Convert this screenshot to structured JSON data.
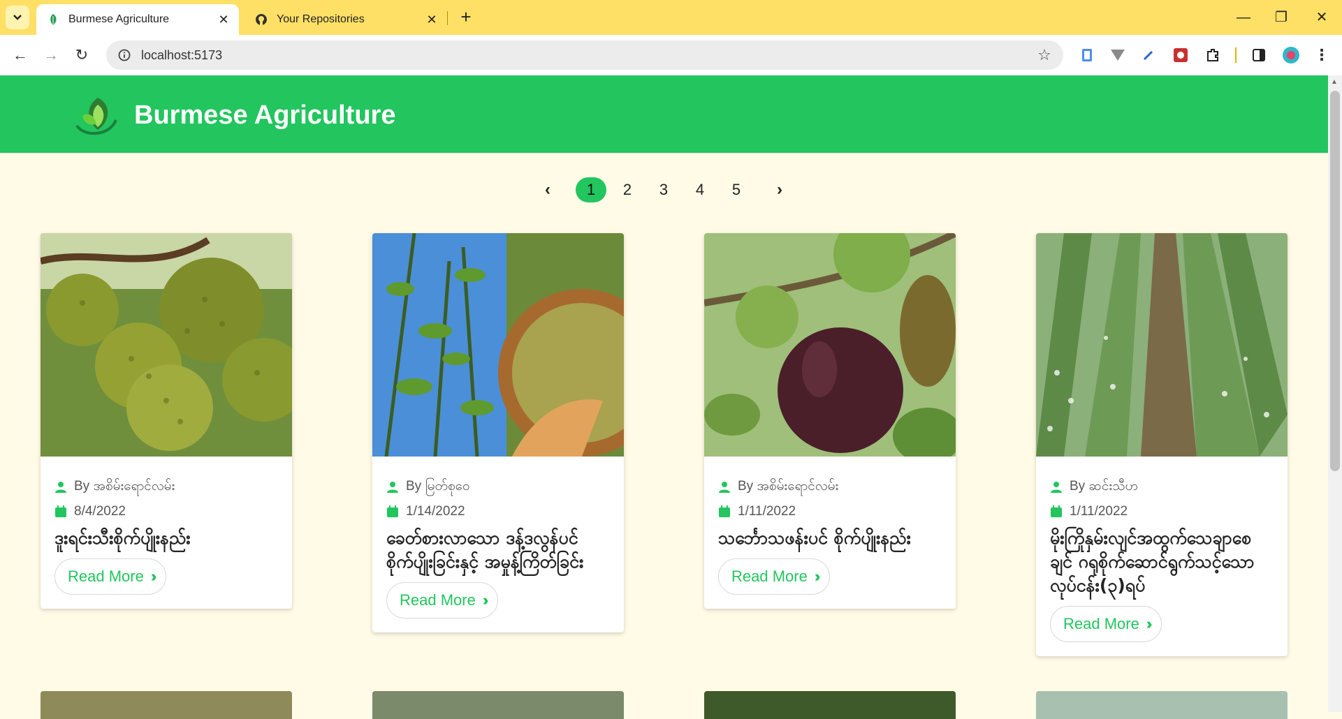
{
  "browser": {
    "tabs": [
      {
        "title": "Burmese Agriculture",
        "active": true
      },
      {
        "title": "Your Repositories",
        "active": false
      }
    ],
    "new_tab": "+",
    "url": "localhost:5173",
    "window_controls": {
      "minimize": "—",
      "restore": "❐",
      "close": "✕"
    }
  },
  "site": {
    "brand": "Burmese Agriculture",
    "accent": "#22c55e",
    "background": "#fffbe6"
  },
  "pagination": {
    "prev": "‹",
    "next": "›",
    "pages": [
      "1",
      "2",
      "3",
      "4",
      "5"
    ],
    "current": "1"
  },
  "posts": [
    {
      "author": "By အစိမ်းရောင်လမ်း",
      "date": "8/4/2022",
      "title": "ဒူးရင်းသီးစိုက်ပျိုးနည်း",
      "read_more": "Read More",
      "image": "durian-fruit-photo"
    },
    {
      "author": "By မြတ်စုဝေ",
      "date": "1/14/2022",
      "title": "ခေတ်စားလာသော ဒန့်ဒလွန်ပင် စိုက်ပျိုးခြင်းနှင့် အမှုန့်ကြိတ်ခြင်း",
      "read_more": "Read More",
      "image": "moringa-powder-photo"
    },
    {
      "author": "By အစိမ်းရောင်လမ်း",
      "date": "1/11/2022",
      "title": "သင်္ဘောသဖန်းပင် စိုက်ပျိုးနည်း",
      "read_more": "Read More",
      "image": "fig-fruit-photo"
    },
    {
      "author": "By ဆင်းသီဟ",
      "date": "1/11/2022",
      "title": "မိုးကြိုနှမ်းလျင်အထွက်သေချာစေချင် ဂရုစိုက်ဆောင်ရွက်သင့်သောလုပ်ငန်း(၃)ရပ်",
      "read_more": "Read More",
      "image": "sesame-field-photo"
    }
  ]
}
